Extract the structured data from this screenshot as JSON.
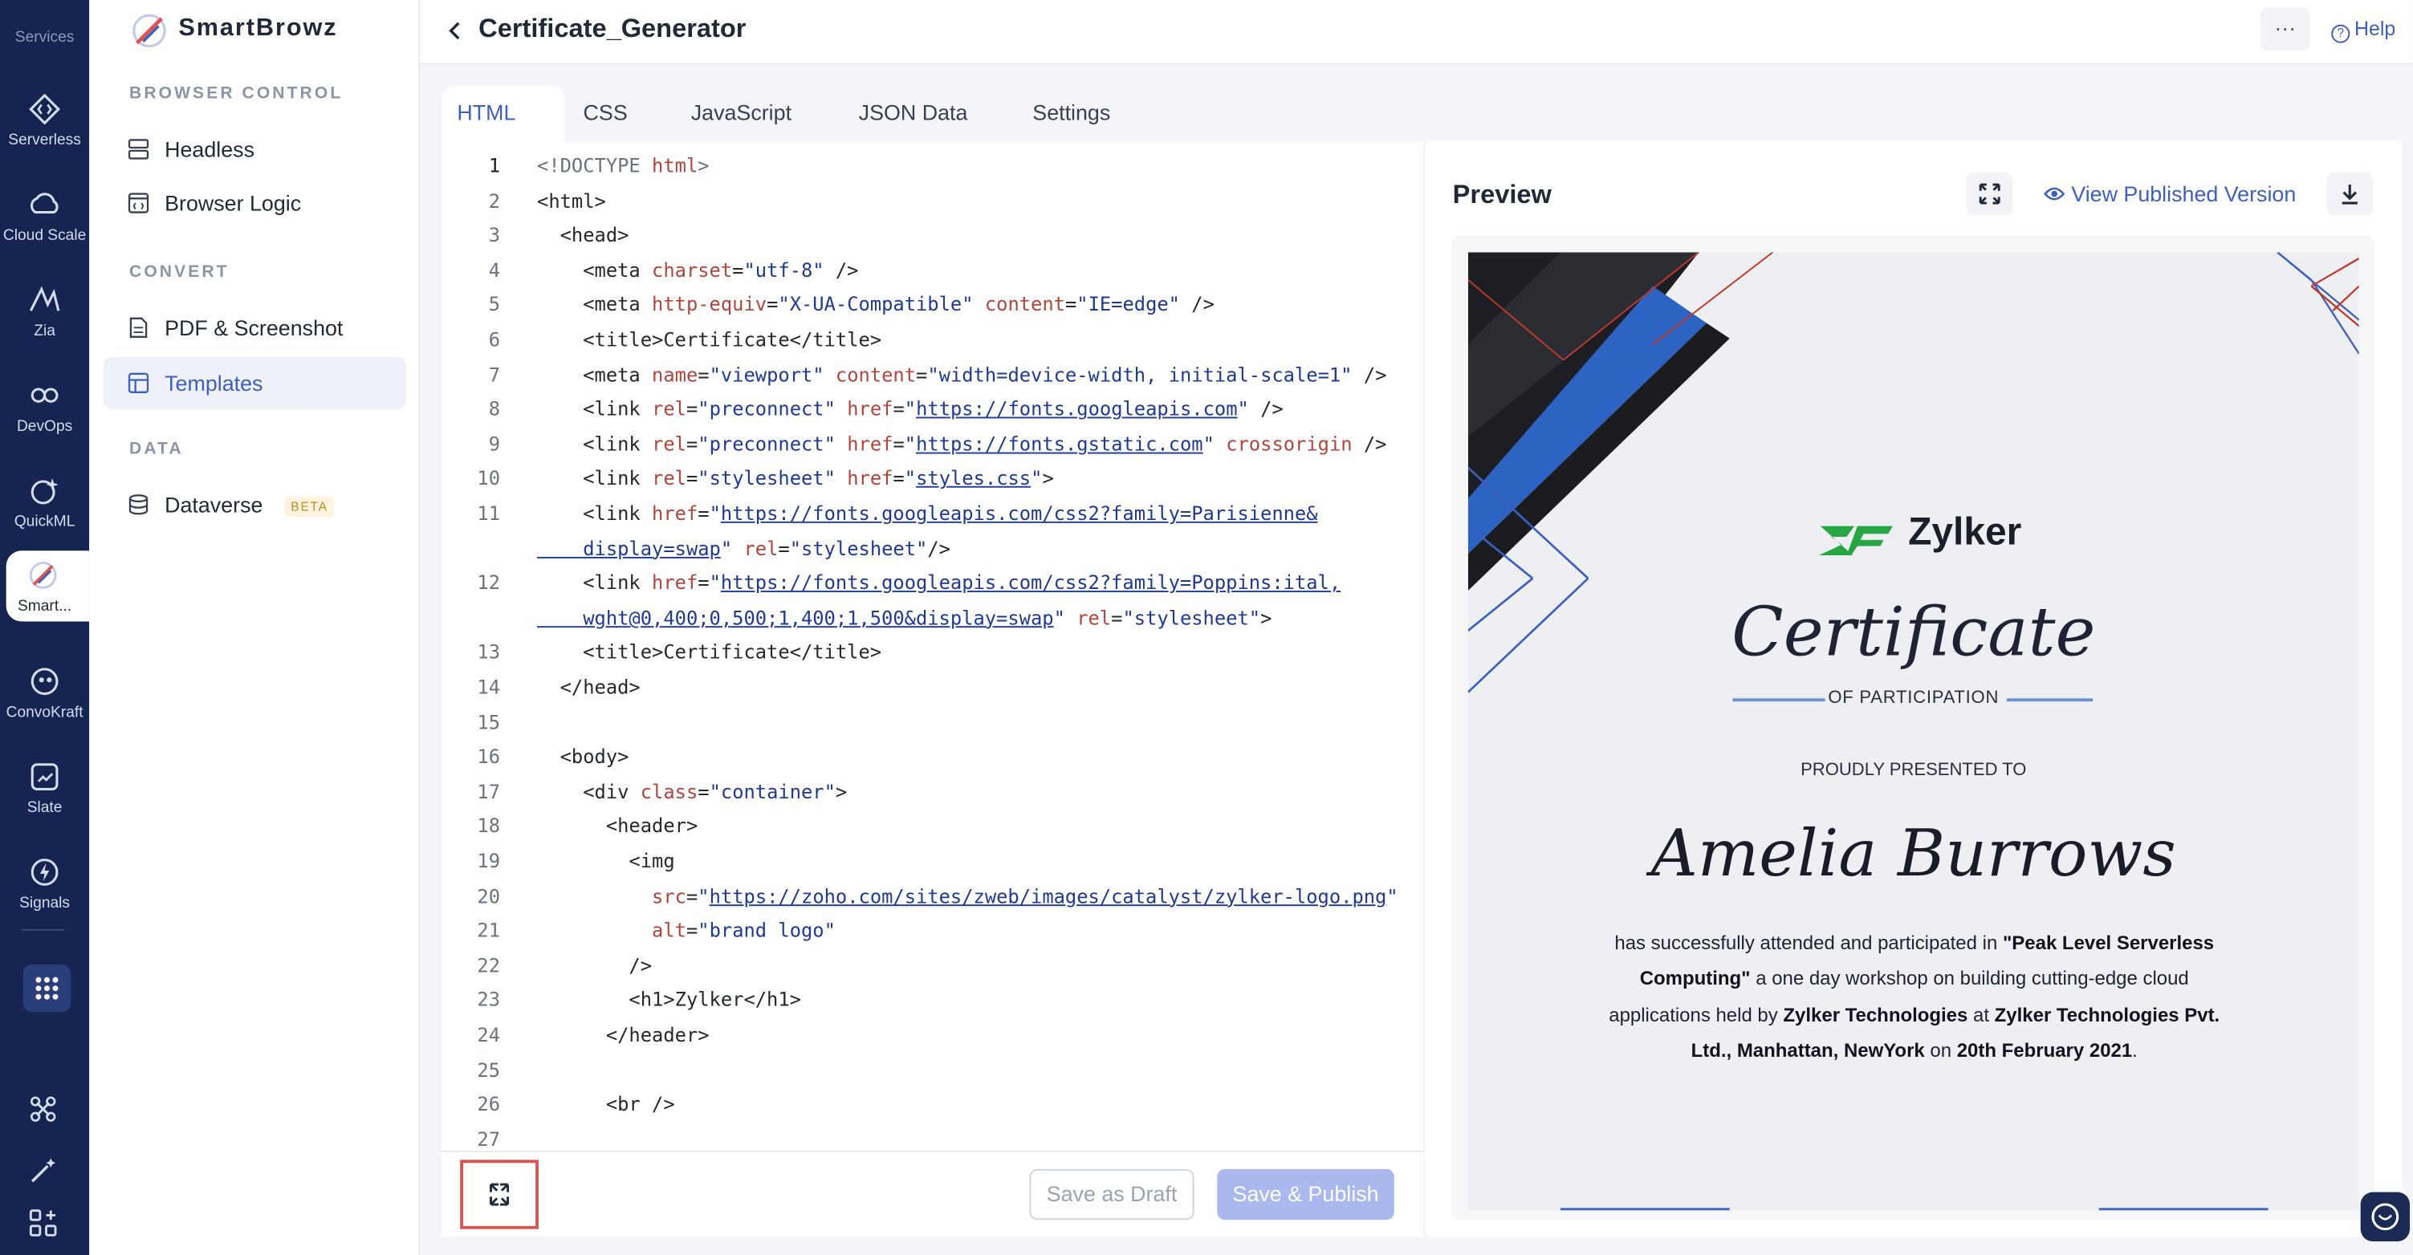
{
  "rail": {
    "title": "Services",
    "items": [
      {
        "label": "Serverless",
        "icon": "serverless-icon"
      },
      {
        "label": "Cloud Scale",
        "icon": "cloud-scale-icon"
      },
      {
        "label": "Zia",
        "icon": "zia-icon"
      },
      {
        "label": "DevOps",
        "icon": "devops-icon"
      },
      {
        "label": "QuickML",
        "icon": "quickml-icon"
      },
      {
        "label": "Smart...",
        "icon": "smartbrowz-icon"
      },
      {
        "label": "ConvoKraft",
        "icon": "convokraft-icon"
      },
      {
        "label": "Slate",
        "icon": "slate-icon"
      },
      {
        "label": "Signals",
        "icon": "signals-icon"
      }
    ]
  },
  "sidebar": {
    "brand": "SmartBrowz",
    "sections": [
      {
        "title": "BROWSER CONTROL",
        "items": [
          "Headless",
          "Browser Logic"
        ]
      },
      {
        "title": "CONVERT",
        "items": [
          "PDF & Screenshot",
          "Templates"
        ]
      },
      {
        "title": "DATA",
        "items": [
          "Dataverse"
        ]
      }
    ],
    "beta_badge": "BETA"
  },
  "header": {
    "title": "Certificate_Generator",
    "help": "Help",
    "more": "···"
  },
  "editor": {
    "tabs": [
      "HTML",
      "CSS",
      "JavaScript",
      "JSON Data",
      "Settings"
    ],
    "active_tab": "HTML",
    "line_numbers": [
      "1",
      "2",
      "3",
      "4",
      "5",
      "6",
      "7",
      "8",
      "9",
      "10",
      "11",
      "",
      "12",
      "",
      "13",
      "14",
      "15",
      "16",
      "17",
      "18",
      "19",
      "20",
      "21",
      "22",
      "23",
      "24",
      "25",
      "26",
      "27"
    ],
    "save_draft": "Save as Draft",
    "save_publish": "Save & Publish"
  },
  "code_lines": [
    [
      {
        "t": "dt",
        "v": "<!DOCTYPE "
      },
      {
        "t": "attr",
        "v": "html"
      },
      {
        "t": "dt",
        "v": ">"
      }
    ],
    [
      {
        "t": "tag",
        "v": "<html>"
      }
    ],
    [
      {
        "t": "tag",
        "v": "  <head>"
      }
    ],
    [
      {
        "t": "tag",
        "v": "    <meta "
      },
      {
        "t": "attr",
        "v": "charset"
      },
      {
        "t": "tag",
        "v": "="
      },
      {
        "t": "str",
        "v": "\"utf-8\""
      },
      {
        "t": "tag",
        "v": " />"
      }
    ],
    [
      {
        "t": "tag",
        "v": "    <meta "
      },
      {
        "t": "attr",
        "v": "http-equiv"
      },
      {
        "t": "tag",
        "v": "="
      },
      {
        "t": "str",
        "v": "\"X-UA-Compatible\""
      },
      {
        "t": "tag",
        "v": " "
      },
      {
        "t": "attr",
        "v": "content"
      },
      {
        "t": "tag",
        "v": "="
      },
      {
        "t": "str",
        "v": "\"IE=edge\""
      },
      {
        "t": "tag",
        "v": " />"
      }
    ],
    [
      {
        "t": "tag",
        "v": "    <title>Certificate</title>"
      }
    ],
    [
      {
        "t": "tag",
        "v": "    <meta "
      },
      {
        "t": "attr",
        "v": "name"
      },
      {
        "t": "tag",
        "v": "="
      },
      {
        "t": "str",
        "v": "\"viewport\""
      },
      {
        "t": "tag",
        "v": " "
      },
      {
        "t": "attr",
        "v": "content"
      },
      {
        "t": "tag",
        "v": "="
      },
      {
        "t": "str",
        "v": "\"width=device-width, initial-scale=1\""
      },
      {
        "t": "tag",
        "v": " />"
      }
    ],
    [
      {
        "t": "tag",
        "v": "    <link "
      },
      {
        "t": "attr",
        "v": "rel"
      },
      {
        "t": "tag",
        "v": "="
      },
      {
        "t": "str",
        "v": "\"preconnect\""
      },
      {
        "t": "tag",
        "v": " "
      },
      {
        "t": "attr",
        "v": "href"
      },
      {
        "t": "tag",
        "v": "="
      },
      {
        "t": "str",
        "v": "\""
      },
      {
        "t": "link",
        "v": "https://fonts.googleapis.com"
      },
      {
        "t": "str",
        "v": "\""
      },
      {
        "t": "tag",
        "v": " />"
      }
    ],
    [
      {
        "t": "tag",
        "v": "    <link "
      },
      {
        "t": "attr",
        "v": "rel"
      },
      {
        "t": "tag",
        "v": "="
      },
      {
        "t": "str",
        "v": "\"preconnect\""
      },
      {
        "t": "tag",
        "v": " "
      },
      {
        "t": "attr",
        "v": "href"
      },
      {
        "t": "tag",
        "v": "="
      },
      {
        "t": "str",
        "v": "\""
      },
      {
        "t": "link",
        "v": "https://fonts.gstatic.com"
      },
      {
        "t": "str",
        "v": "\""
      },
      {
        "t": "tag",
        "v": " "
      },
      {
        "t": "attr",
        "v": "crossorigin"
      },
      {
        "t": "tag",
        "v": " />"
      }
    ],
    [
      {
        "t": "tag",
        "v": "    <link "
      },
      {
        "t": "attr",
        "v": "rel"
      },
      {
        "t": "tag",
        "v": "="
      },
      {
        "t": "str",
        "v": "\"stylesheet\""
      },
      {
        "t": "tag",
        "v": " "
      },
      {
        "t": "attr",
        "v": "href"
      },
      {
        "t": "tag",
        "v": "="
      },
      {
        "t": "str",
        "v": "\""
      },
      {
        "t": "link",
        "v": "styles.css"
      },
      {
        "t": "str",
        "v": "\""
      },
      {
        "t": "tag",
        "v": ">"
      }
    ],
    [
      {
        "t": "tag",
        "v": "    <link "
      },
      {
        "t": "attr",
        "v": "href"
      },
      {
        "t": "tag",
        "v": "="
      },
      {
        "t": "str",
        "v": "\""
      },
      {
        "t": "link",
        "v": "https://fonts.googleapis.com/css2?family=Parisienne&"
      }
    ],
    [
      {
        "t": "link",
        "v": "    display=swap"
      },
      {
        "t": "str",
        "v": "\""
      },
      {
        "t": "tag",
        "v": " "
      },
      {
        "t": "attr",
        "v": "rel"
      },
      {
        "t": "tag",
        "v": "="
      },
      {
        "t": "str",
        "v": "\"stylesheet\""
      },
      {
        "t": "tag",
        "v": "/>"
      }
    ],
    [
      {
        "t": "tag",
        "v": "    <link "
      },
      {
        "t": "attr",
        "v": "href"
      },
      {
        "t": "tag",
        "v": "="
      },
      {
        "t": "str",
        "v": "\""
      },
      {
        "t": "link",
        "v": "https://fonts.googleapis.com/css2?family=Poppins:ital,"
      }
    ],
    [
      {
        "t": "link",
        "v": "    wght@0,400;0,500;1,400;1,500&display=swap"
      },
      {
        "t": "str",
        "v": "\""
      },
      {
        "t": "tag",
        "v": " "
      },
      {
        "t": "attr",
        "v": "rel"
      },
      {
        "t": "tag",
        "v": "="
      },
      {
        "t": "str",
        "v": "\"stylesheet\""
      },
      {
        "t": "tag",
        "v": ">"
      }
    ],
    [
      {
        "t": "tag",
        "v": "    <title>Certificate</title>"
      }
    ],
    [
      {
        "t": "tag",
        "v": "  </head>"
      }
    ],
    [
      {
        "t": "tag",
        "v": ""
      }
    ],
    [
      {
        "t": "tag",
        "v": "  <body>"
      }
    ],
    [
      {
        "t": "tag",
        "v": "    <div "
      },
      {
        "t": "attr",
        "v": "class"
      },
      {
        "t": "tag",
        "v": "="
      },
      {
        "t": "str",
        "v": "\"container\""
      },
      {
        "t": "tag",
        "v": ">"
      }
    ],
    [
      {
        "t": "tag",
        "v": "      <header>"
      }
    ],
    [
      {
        "t": "tag",
        "v": "        <img"
      }
    ],
    [
      {
        "t": "tag",
        "v": "          "
      },
      {
        "t": "attr",
        "v": "src"
      },
      {
        "t": "tag",
        "v": "="
      },
      {
        "t": "str",
        "v": "\""
      },
      {
        "t": "link",
        "v": "https://zoho.com/sites/zweb/images/catalyst/zylker-logo.png"
      },
      {
        "t": "str",
        "v": "\""
      }
    ],
    [
      {
        "t": "tag",
        "v": "          "
      },
      {
        "t": "attr",
        "v": "alt"
      },
      {
        "t": "tag",
        "v": "="
      },
      {
        "t": "str",
        "v": "\"brand logo\""
      }
    ],
    [
      {
        "t": "tag",
        "v": "        />"
      }
    ],
    [
      {
        "t": "tag",
        "v": "        <h1>Zylker</h1>"
      }
    ],
    [
      {
        "t": "tag",
        "v": "      </header>"
      }
    ],
    [
      {
        "t": "tag",
        "v": ""
      }
    ],
    [
      {
        "t": "tag",
        "v": "      <br />"
      }
    ],
    [
      {
        "t": "tag",
        "v": ""
      }
    ]
  ],
  "preview": {
    "title": "Preview",
    "view_published": "View Published Version",
    "certificate": {
      "brand": "Zylker",
      "title": "Certificate",
      "subtitle": "OF PARTICIPATION",
      "presented": "PROUDLY PRESENTED TO",
      "name": "Amelia Burrows",
      "body_segments": [
        {
          "b": false,
          "v": "has successfully attended and participated in "
        },
        {
          "b": true,
          "v": "\"Peak Level Serverless Computing\""
        },
        {
          "b": false,
          "v": " a one day workshop on building cutting-edge cloud applications held by "
        },
        {
          "b": true,
          "v": "Zylker Technologies"
        },
        {
          "b": false,
          "v": " at "
        },
        {
          "b": true,
          "v": "Zylker Technologies Pvt. Ltd., Manhattan, NewYork"
        },
        {
          "b": false,
          "v": " on "
        },
        {
          "b": true,
          "v": "20th February 2021"
        },
        {
          "b": false,
          "v": "."
        }
      ]
    }
  },
  "colors": {
    "rail_bg": "#152451",
    "accent": "#3d5fbf",
    "highlight_border": "#d9534f",
    "publish_disabled": "#a9b9ee"
  }
}
